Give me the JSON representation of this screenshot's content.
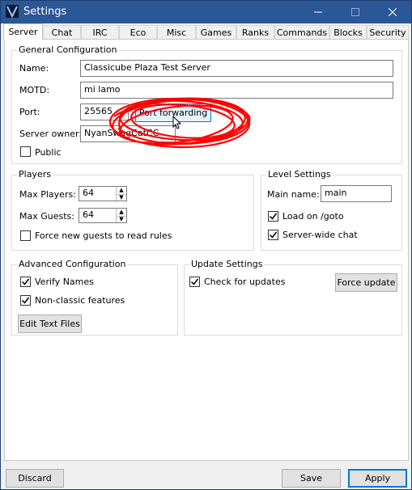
{
  "window": {
    "title": "Settings"
  },
  "tabs": [
    "Server",
    "Chat",
    "IRC",
    "Eco",
    "Misc",
    "Games",
    "Ranks",
    "Commands",
    "Blocks",
    "Security"
  ],
  "general": {
    "title": "General Configuration",
    "name_label": "Name:",
    "name_value": "Classicube Plaza Test Server",
    "motd_label": "MOTD:",
    "motd_value": "mi lamo",
    "port_label": "Port:",
    "port_value": "25565",
    "port_forward_label": "Port forwarding",
    "owner_label": "Server owner:",
    "owner_value": "NyanSwagCatCC",
    "public_label": "Public"
  },
  "players": {
    "title": "Players",
    "max_players_label": "Max Players:",
    "max_players_value": "64",
    "max_guests_label": "Max Guests:",
    "max_guests_value": "64",
    "force_rules_label": "Force new guests to read rules"
  },
  "level": {
    "title": "Level Settings",
    "main_name_label": "Main name:",
    "main_name_value": "main",
    "load_goto_label": "Load on /goto",
    "server_chat_label": "Server-wide chat"
  },
  "advanced": {
    "title": "Advanced Configuration",
    "verify_label": "Verify Names",
    "nonclassic_label": "Non-classic features",
    "edit_text_label": "Edit Text Files"
  },
  "update": {
    "title": "Update Settings",
    "check_label": "Check for updates",
    "force_label": "Force update"
  },
  "footer": {
    "discard": "Discard",
    "save": "Save",
    "apply": "Apply"
  },
  "colors": {
    "titlebar": "#2b5797",
    "scribble": "#ff0000"
  }
}
